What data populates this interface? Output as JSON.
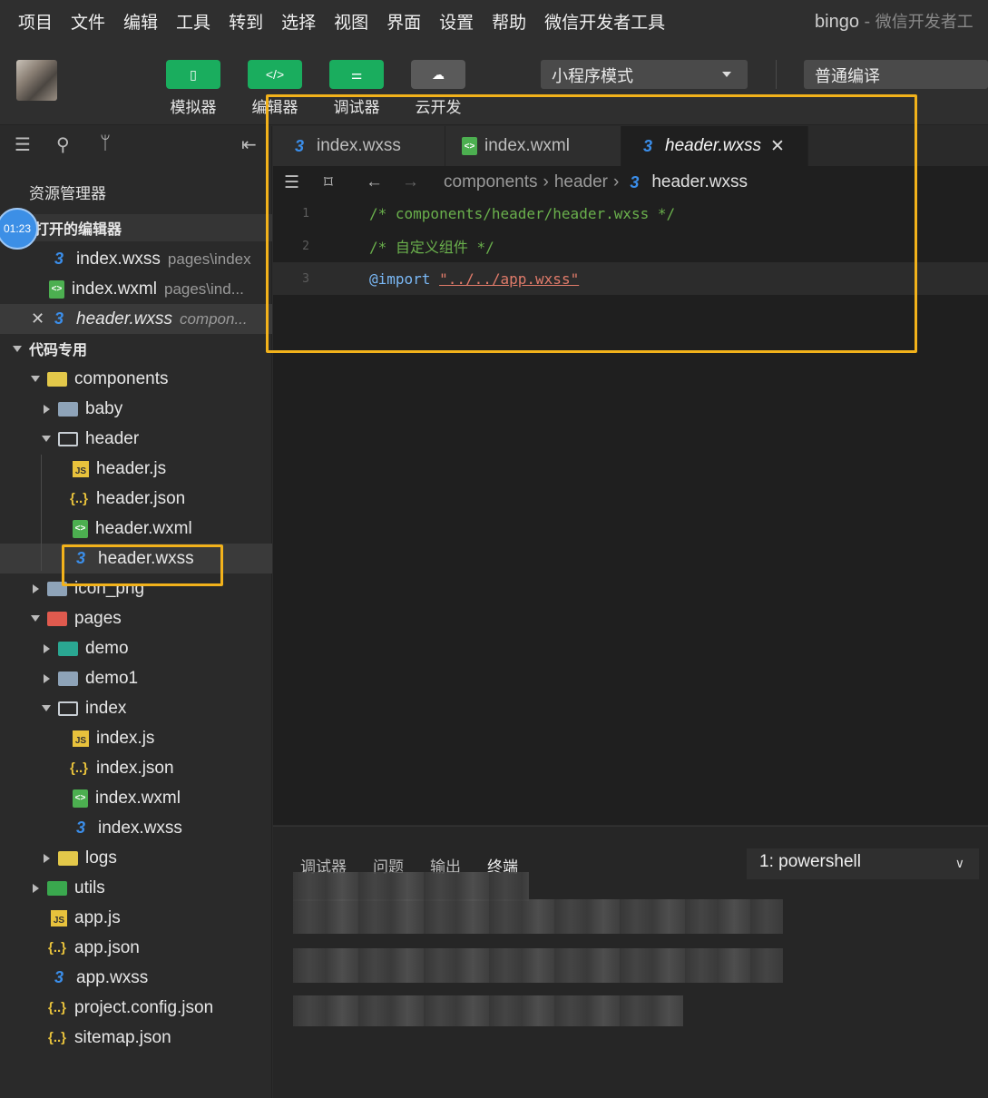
{
  "menu": [
    "项目",
    "文件",
    "编辑",
    "工具",
    "转到",
    "选择",
    "视图",
    "界面",
    "设置",
    "帮助",
    "微信开发者工具"
  ],
  "app_title": {
    "name": "bingo",
    "sep": " - ",
    "subtitle": "微信开发者工"
  },
  "toolbar": {
    "simulator": "模拟器",
    "editor": "编辑器",
    "debugger": "调试器",
    "cloud": "云开发",
    "mode": "小程序模式",
    "compile": "普通编译"
  },
  "sidebar": {
    "panel_title": "资源管理器",
    "clock": "01:23",
    "open_editors_label": "打开的编辑器",
    "open_editors": [
      {
        "name": "index.wxss",
        "path": "pages\\index"
      },
      {
        "name": "index.wxml",
        "path": "pages\\ind..."
      },
      {
        "name": "header.wxss",
        "path": "compon..."
      }
    ],
    "project_label": "代码专用",
    "tree": {
      "components": "components",
      "baby": "baby",
      "header": "header",
      "header_js": "header.js",
      "header_json": "header.json",
      "header_wxml": "header.wxml",
      "header_wxss": "header.wxss",
      "icon_png": "icon_png",
      "pages": "pages",
      "demo": "demo",
      "demo1": "demo1",
      "index": "index",
      "index_js": "index.js",
      "index_json": "index.json",
      "index_wxml": "index.wxml",
      "index_wxss": "index.wxss",
      "logs": "logs",
      "utils": "utils",
      "app_js": "app.js",
      "app_json": "app.json",
      "app_wxss": "app.wxss",
      "project_config": "project.config.json",
      "sitemap": "sitemap.json"
    }
  },
  "editor": {
    "tabs": [
      {
        "name": "index.wxss"
      },
      {
        "name": "index.wxml"
      },
      {
        "name": "header.wxss",
        "close": "✕"
      }
    ],
    "breadcrumb": [
      "components",
      "header",
      "header.wxss"
    ],
    "lines": [
      {
        "num": "1",
        "text": "/* components/header/header.wxss */"
      },
      {
        "num": "2",
        "text": "/* 自定义组件 */"
      },
      {
        "num": "3",
        "keyword": "@import",
        "string": "\"../../app.wxss\""
      }
    ]
  },
  "bottom_panel": {
    "tabs": [
      "调试器",
      "问题",
      "输出",
      "终端"
    ],
    "terminal_select": "1: powershell"
  },
  "colors": {
    "accent_green": "#1aad5e",
    "highlight": "#f2b21b",
    "css_icon": "#3b8eea"
  }
}
